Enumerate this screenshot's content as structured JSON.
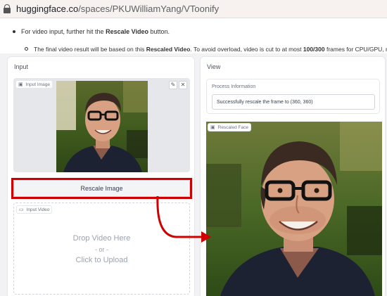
{
  "browser": {
    "url_domain": "huggingface.co",
    "url_path": "/spaces/PKUWilliamYang/VToonify"
  },
  "readme": {
    "bullet1_prefix": "For video input, further hit the ",
    "bullet1_bold": "Rescale Video",
    "bullet1_suffix": " button.",
    "bullet2_prefix": "The final video result will be based on this ",
    "bullet2_bold": "Rescaled Video",
    "bullet2_middle": ". To avoid overload, video is cut to at most ",
    "bullet2_bold2": "100/300",
    "bullet2_suffix": " frames for CPU/GPU, respecti"
  },
  "input_panel": {
    "title": "Input",
    "image_tag": "Input Image",
    "rescale_button": "Rescale Image",
    "video_tag": "Input Video",
    "drop_main": "Drop Video Here",
    "drop_or": "- or -",
    "drop_click": "Click to Upload"
  },
  "view_panel": {
    "title": "View",
    "process_label": "Process Information",
    "process_value": "Successfully rescale the frame to (360, 360)",
    "rescaled_tag": "Rescaled Face"
  },
  "colors": {
    "highlight": "#d00000",
    "panel_bg": "#ffffff",
    "app_bg": "#f2f2f4"
  },
  "icons": [
    "lock-icon",
    "image-icon",
    "edit-icon",
    "close-icon",
    "video-icon",
    "arrow-annotation"
  ]
}
